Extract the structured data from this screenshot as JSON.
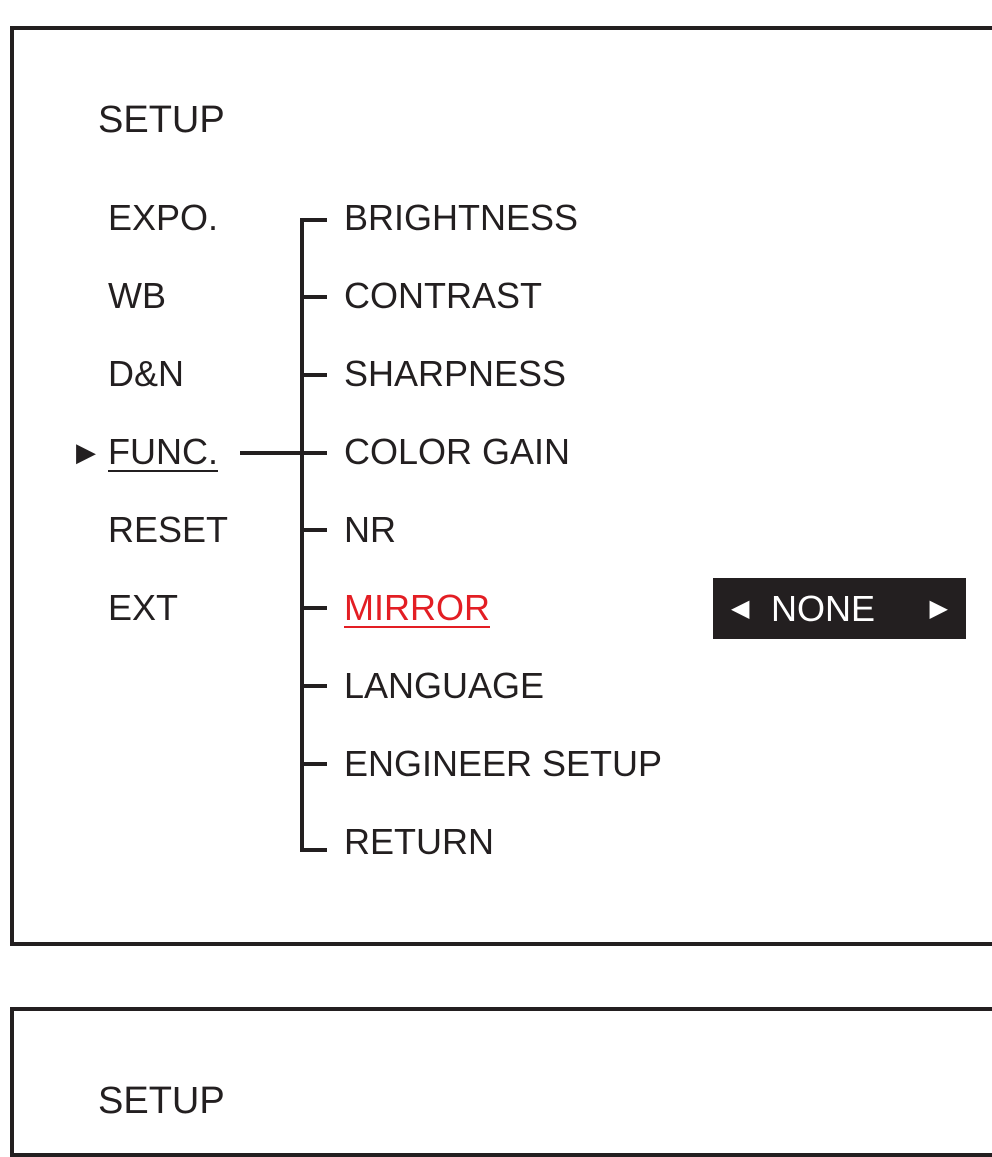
{
  "panel1": {
    "title": "SETUP",
    "selector_icon": "triangle-right-icon",
    "menu": [
      "EXPO.",
      "WB",
      "D&N",
      "FUNC.",
      "RESET",
      "EXT"
    ],
    "selected_menu": "FUNC.",
    "submenu": [
      "BRIGHTNESS",
      "CONTRAST",
      "SHARPNESS",
      "COLOR GAIN",
      "NR",
      "MIRROR",
      "LANGUAGE",
      "ENGINEER SETUP",
      "RETURN"
    ],
    "active_submenu": "MIRROR",
    "active_color": "#e31e24",
    "value": {
      "left_arrow": "◀",
      "text": "NONE",
      "right_arrow": "▶"
    }
  },
  "panel2": {
    "title": "SETUP"
  }
}
